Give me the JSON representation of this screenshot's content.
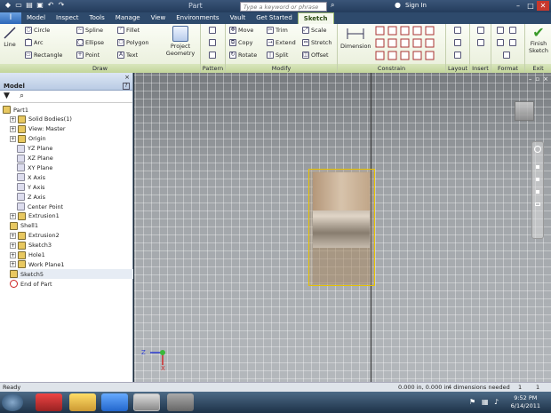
{
  "titlebar": {
    "doc_title": "Part",
    "search_placeholder": "Type a keyword or phrase",
    "signin": "Sign In",
    "min": "–",
    "max": "□",
    "close": "✕"
  },
  "menu": {
    "tabs": [
      "Model",
      "Inspect",
      "Tools",
      "Manage",
      "View",
      "Environments",
      "Vault",
      "Get Started",
      "Sketch"
    ],
    "active": "Sketch"
  },
  "ribbon": {
    "draw": {
      "label": "Draw",
      "line": "Line",
      "circle": "Circle",
      "arc": "Arc",
      "rectangle": "Rectangle",
      "spline": "Spline",
      "ellipse": "Ellipse",
      "point": "Point",
      "fillet": "Fillet",
      "polygon": "Polygon",
      "text": "Text",
      "project_geometry": "Project Geometry"
    },
    "pattern": {
      "label": "Pattern"
    },
    "modify": {
      "label": "Modify",
      "move": "Move",
      "copy": "Copy",
      "rotate": "Rotate",
      "trim": "Trim",
      "extend": "Extend",
      "split": "Split",
      "scale": "Scale",
      "stretch": "Stretch",
      "offset": "Offset"
    },
    "constrain": {
      "label": "Constrain",
      "dimension": "Dimension"
    },
    "layout": {
      "label": "Layout"
    },
    "insert": {
      "label": "Insert"
    },
    "format": {
      "label": "Format"
    },
    "exit": {
      "label": "Exit",
      "finish": "Finish Sketch"
    }
  },
  "browser": {
    "title": "Model",
    "close": "×",
    "help": "?",
    "items": [
      "Part1",
      "Solid Bodies(1)",
      "View: Master",
      "Origin",
      "YZ Plane",
      "XZ Plane",
      "XY Plane",
      "X Axis",
      "Y Axis",
      "Z Axis",
      "Center Point",
      "Extrusion1",
      "Shell1",
      "Extrusion2",
      "Sketch3",
      "Hole1",
      "Work Plane1",
      "Sketch5",
      "End of Part"
    ]
  },
  "triad": {
    "z": "Z",
    "x": "X"
  },
  "status": {
    "left": "Ready",
    "coords": "0.000 in, 0.000 in",
    "dims": "4 dimensions needed",
    "n1": "1",
    "n2": "1"
  },
  "taskbar": {
    "time": "9:52 PM",
    "date": "6/14/2011"
  }
}
